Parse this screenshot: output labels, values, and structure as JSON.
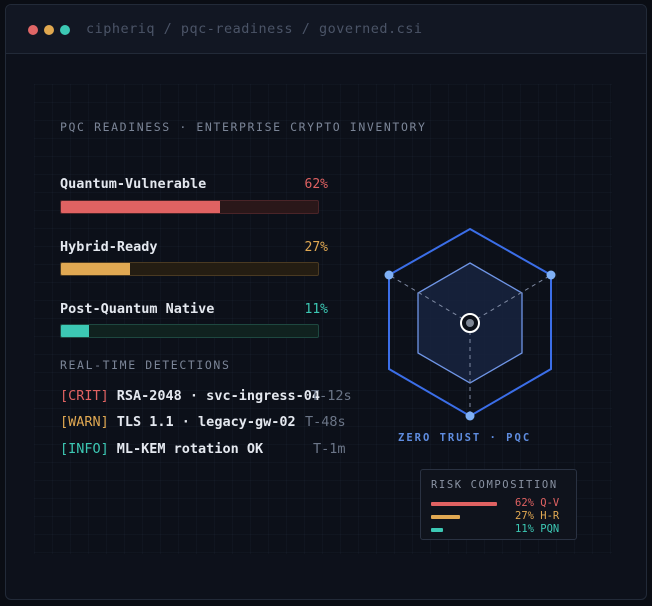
{
  "window": {
    "path": "cipheriq / pqc-readiness / governed.csi"
  },
  "panel": {
    "heading": "PQC READINESS · ENTERPRISE CRYPTO INVENTORY",
    "metrics": [
      {
        "label": "Quantum-Vulnerable",
        "percent_text": "62%",
        "value": 0.62,
        "color": "#e06262",
        "track": "#2a1719",
        "border": "#4a2428"
      },
      {
        "label": "Hybrid-Ready",
        "percent_text": "27%",
        "value": 0.27,
        "color": "#e0a852",
        "track": "#241d12",
        "border": "#4a3a22"
      },
      {
        "label": "Post-Quantum Native",
        "percent_text": "11%",
        "value": 0.11,
        "color": "#3cc8b4",
        "track": "#10221f",
        "border": "#1e4840"
      }
    ],
    "detections_heading": "REAL-TIME DETECTIONS",
    "detections": [
      {
        "tag": "[CRIT]",
        "message": "RSA-2048 · svc-ingress-04",
        "time": "T-12s",
        "color": "#e06262"
      },
      {
        "tag": "[WARN]",
        "message": "TLS 1.1 · legacy-gw-02",
        "time": "T-48s",
        "color": "#e0a852"
      },
      {
        "tag": "[INFO]",
        "message": "ML-KEM rotation OK",
        "time": "T-1m",
        "color": "#3cc8b4"
      }
    ],
    "radar_caption": "ZERO TRUST · PQC",
    "legend": {
      "title": "RISK COMPOSITION",
      "items": [
        {
          "text": "62% Q-V",
          "value": 0.62,
          "color": "#e06262"
        },
        {
          "text": "27% H-R",
          "value": 0.27,
          "color": "#e0a852"
        },
        {
          "text": "11% PQN",
          "value": 0.11,
          "color": "#3cc8b4"
        }
      ]
    }
  }
}
